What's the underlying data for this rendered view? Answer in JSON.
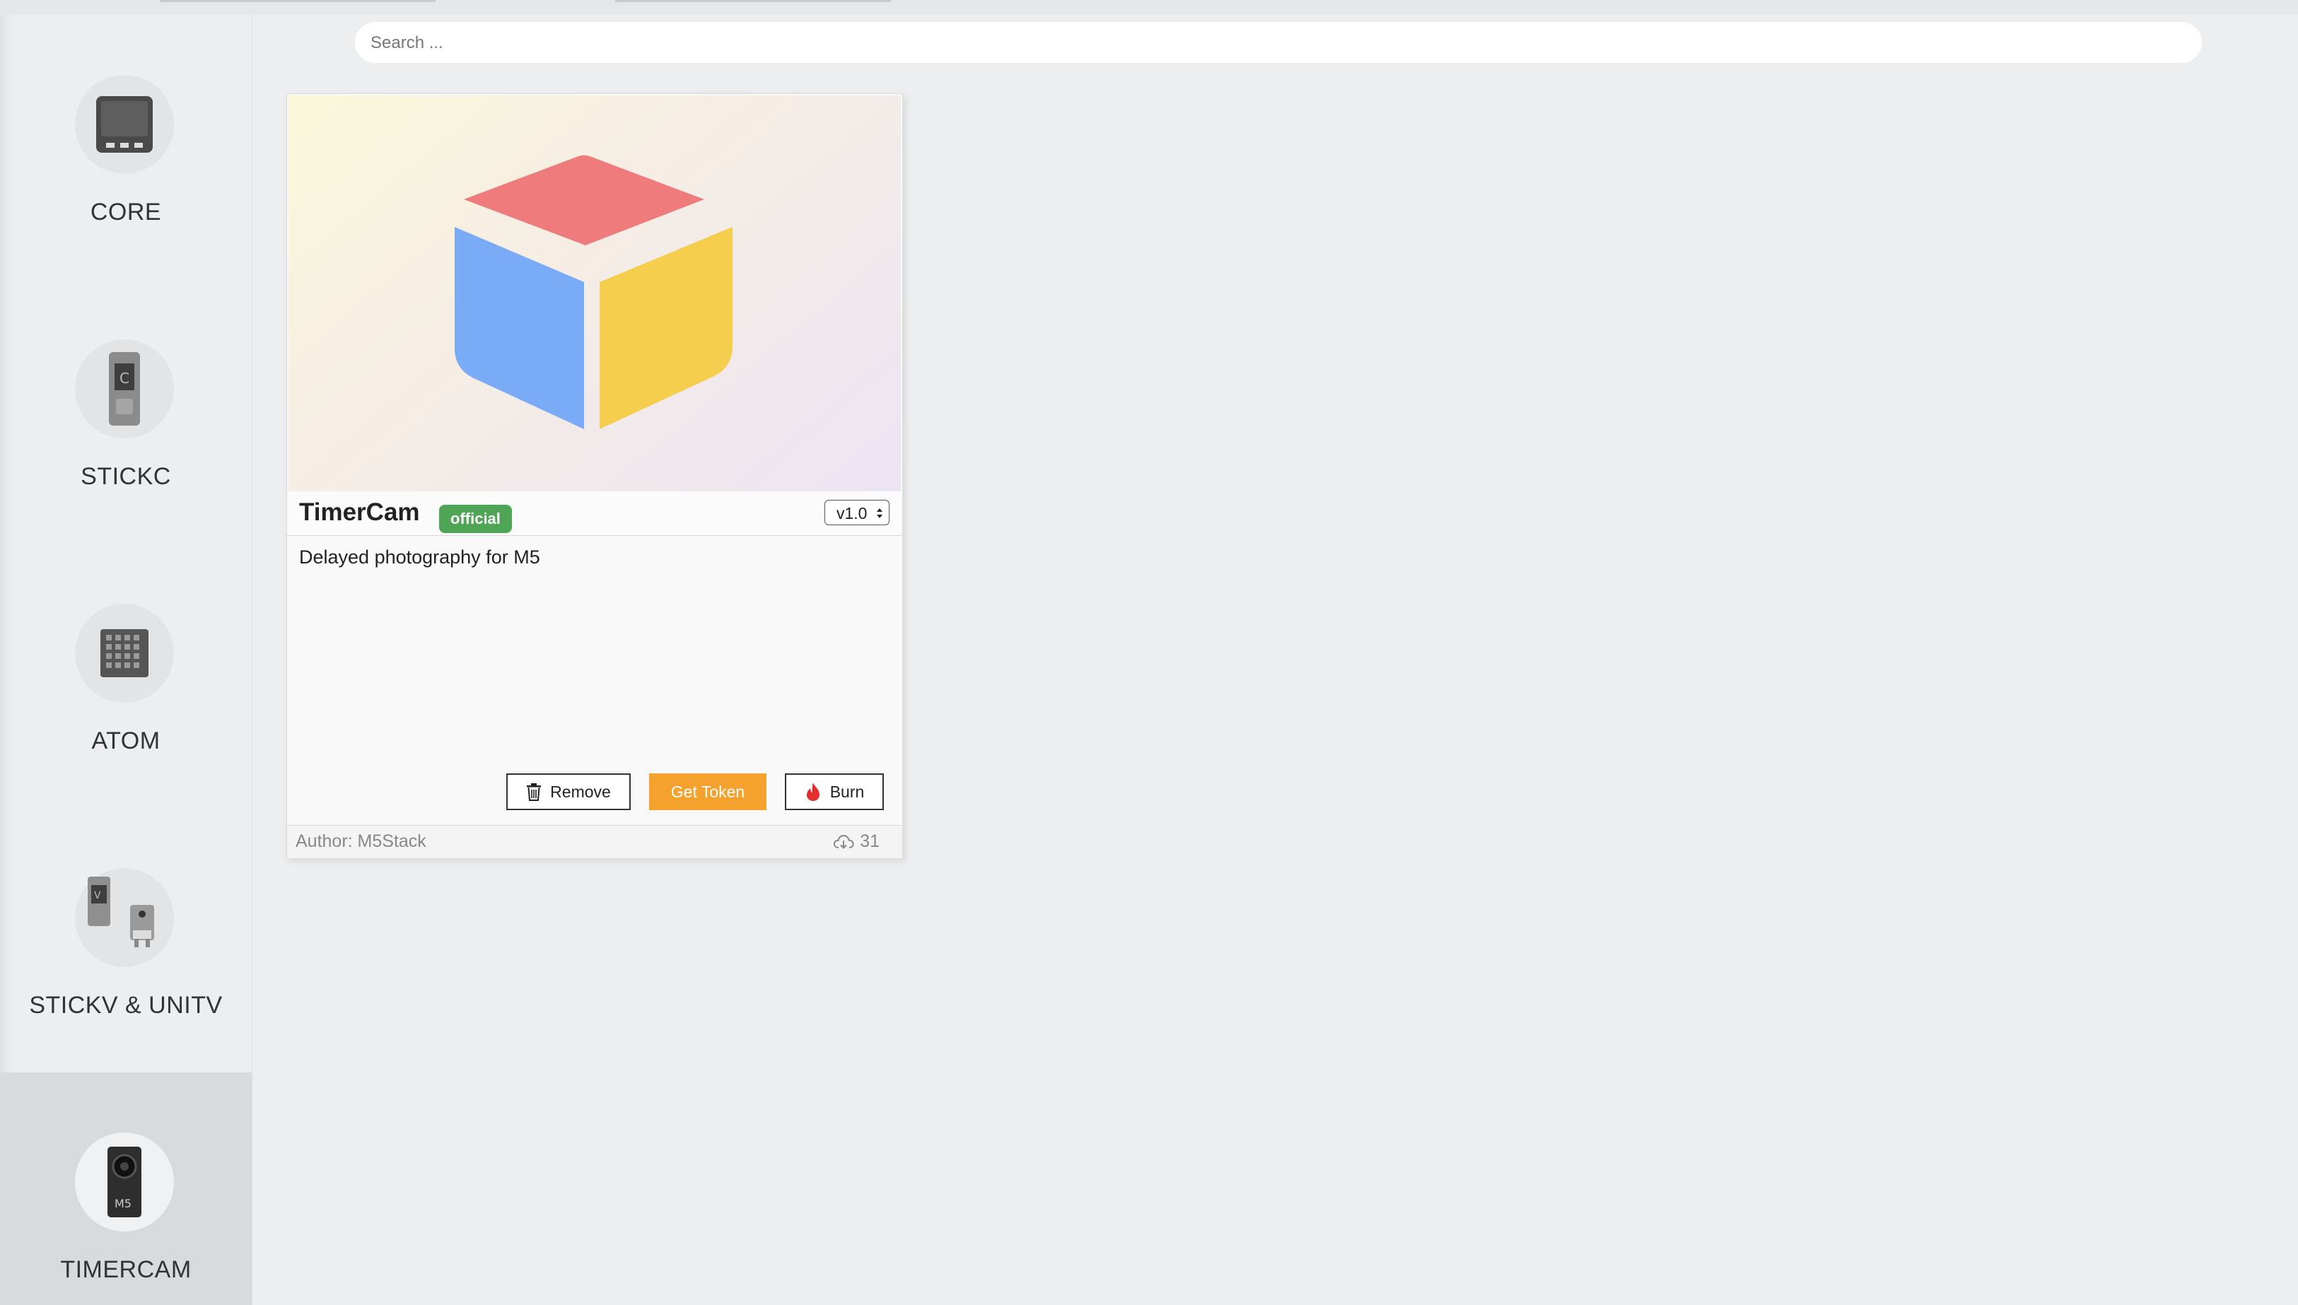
{
  "search": {
    "placeholder": "Search ..."
  },
  "sidebar": {
    "items": [
      {
        "label": "CORE",
        "icon": "core-device-icon",
        "active": false
      },
      {
        "label": "STICKC",
        "icon": "stickc-device-icon",
        "active": false
      },
      {
        "label": "ATOM",
        "icon": "atom-device-icon",
        "active": false
      },
      {
        "label": "STICKV & UNITV",
        "icon": "stickv-unitv-device-icon",
        "active": false
      },
      {
        "label": "TIMERCAM",
        "icon": "timercam-device-icon",
        "active": true
      }
    ]
  },
  "card": {
    "image_icon": "cube-logo-icon",
    "title": "TimerCam",
    "badge": "official",
    "version": "v1.0",
    "description": "Delayed photography for M5",
    "buttons": {
      "remove": "Remove",
      "get_token": "Get Token",
      "burn": "Burn"
    },
    "author": "Author: M5Stack",
    "downloads": "31"
  },
  "colors": {
    "badge_green": "#4fa556",
    "token_orange": "#f4a22d",
    "cube_red": "#f07b7c",
    "cube_blue": "#7aabf7",
    "cube_yellow": "#f6ce4e",
    "burn_red": "#e52e2e"
  }
}
